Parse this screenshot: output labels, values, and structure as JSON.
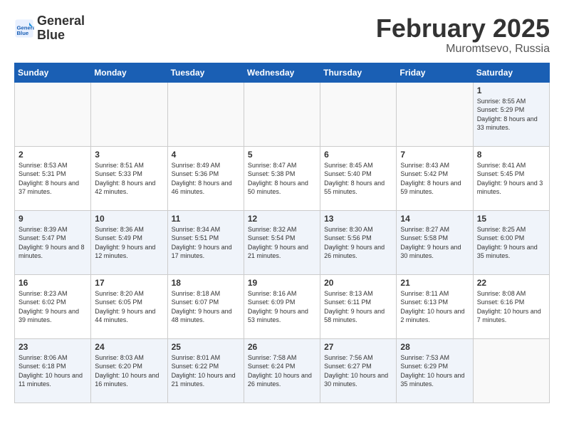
{
  "logo": {
    "line1": "General",
    "line2": "Blue"
  },
  "title": "February 2025",
  "location": "Muromtsevo, Russia",
  "days_of_week": [
    "Sunday",
    "Monday",
    "Tuesday",
    "Wednesday",
    "Thursday",
    "Friday",
    "Saturday"
  ],
  "weeks": [
    [
      {
        "day": "",
        "info": ""
      },
      {
        "day": "",
        "info": ""
      },
      {
        "day": "",
        "info": ""
      },
      {
        "day": "",
        "info": ""
      },
      {
        "day": "",
        "info": ""
      },
      {
        "day": "",
        "info": ""
      },
      {
        "day": "1",
        "info": "Sunrise: 8:55 AM\nSunset: 5:29 PM\nDaylight: 8 hours and 33 minutes."
      }
    ],
    [
      {
        "day": "2",
        "info": "Sunrise: 8:53 AM\nSunset: 5:31 PM\nDaylight: 8 hours and 37 minutes."
      },
      {
        "day": "3",
        "info": "Sunrise: 8:51 AM\nSunset: 5:33 PM\nDaylight: 8 hours and 42 minutes."
      },
      {
        "day": "4",
        "info": "Sunrise: 8:49 AM\nSunset: 5:36 PM\nDaylight: 8 hours and 46 minutes."
      },
      {
        "day": "5",
        "info": "Sunrise: 8:47 AM\nSunset: 5:38 PM\nDaylight: 8 hours and 50 minutes."
      },
      {
        "day": "6",
        "info": "Sunrise: 8:45 AM\nSunset: 5:40 PM\nDaylight: 8 hours and 55 minutes."
      },
      {
        "day": "7",
        "info": "Sunrise: 8:43 AM\nSunset: 5:42 PM\nDaylight: 8 hours and 59 minutes."
      },
      {
        "day": "8",
        "info": "Sunrise: 8:41 AM\nSunset: 5:45 PM\nDaylight: 9 hours and 3 minutes."
      }
    ],
    [
      {
        "day": "9",
        "info": "Sunrise: 8:39 AM\nSunset: 5:47 PM\nDaylight: 9 hours and 8 minutes."
      },
      {
        "day": "10",
        "info": "Sunrise: 8:36 AM\nSunset: 5:49 PM\nDaylight: 9 hours and 12 minutes."
      },
      {
        "day": "11",
        "info": "Sunrise: 8:34 AM\nSunset: 5:51 PM\nDaylight: 9 hours and 17 minutes."
      },
      {
        "day": "12",
        "info": "Sunrise: 8:32 AM\nSunset: 5:54 PM\nDaylight: 9 hours and 21 minutes."
      },
      {
        "day": "13",
        "info": "Sunrise: 8:30 AM\nSunset: 5:56 PM\nDaylight: 9 hours and 26 minutes."
      },
      {
        "day": "14",
        "info": "Sunrise: 8:27 AM\nSunset: 5:58 PM\nDaylight: 9 hours and 30 minutes."
      },
      {
        "day": "15",
        "info": "Sunrise: 8:25 AM\nSunset: 6:00 PM\nDaylight: 9 hours and 35 minutes."
      }
    ],
    [
      {
        "day": "16",
        "info": "Sunrise: 8:23 AM\nSunset: 6:02 PM\nDaylight: 9 hours and 39 minutes."
      },
      {
        "day": "17",
        "info": "Sunrise: 8:20 AM\nSunset: 6:05 PM\nDaylight: 9 hours and 44 minutes."
      },
      {
        "day": "18",
        "info": "Sunrise: 8:18 AM\nSunset: 6:07 PM\nDaylight: 9 hours and 48 minutes."
      },
      {
        "day": "19",
        "info": "Sunrise: 8:16 AM\nSunset: 6:09 PM\nDaylight: 9 hours and 53 minutes."
      },
      {
        "day": "20",
        "info": "Sunrise: 8:13 AM\nSunset: 6:11 PM\nDaylight: 9 hours and 58 minutes."
      },
      {
        "day": "21",
        "info": "Sunrise: 8:11 AM\nSunset: 6:13 PM\nDaylight: 10 hours and 2 minutes."
      },
      {
        "day": "22",
        "info": "Sunrise: 8:08 AM\nSunset: 6:16 PM\nDaylight: 10 hours and 7 minutes."
      }
    ],
    [
      {
        "day": "23",
        "info": "Sunrise: 8:06 AM\nSunset: 6:18 PM\nDaylight: 10 hours and 11 minutes."
      },
      {
        "day": "24",
        "info": "Sunrise: 8:03 AM\nSunset: 6:20 PM\nDaylight: 10 hours and 16 minutes."
      },
      {
        "day": "25",
        "info": "Sunrise: 8:01 AM\nSunset: 6:22 PM\nDaylight: 10 hours and 21 minutes."
      },
      {
        "day": "26",
        "info": "Sunrise: 7:58 AM\nSunset: 6:24 PM\nDaylight: 10 hours and 26 minutes."
      },
      {
        "day": "27",
        "info": "Sunrise: 7:56 AM\nSunset: 6:27 PM\nDaylight: 10 hours and 30 minutes."
      },
      {
        "day": "28",
        "info": "Sunrise: 7:53 AM\nSunset: 6:29 PM\nDaylight: 10 hours and 35 minutes."
      },
      {
        "day": "",
        "info": ""
      }
    ]
  ]
}
